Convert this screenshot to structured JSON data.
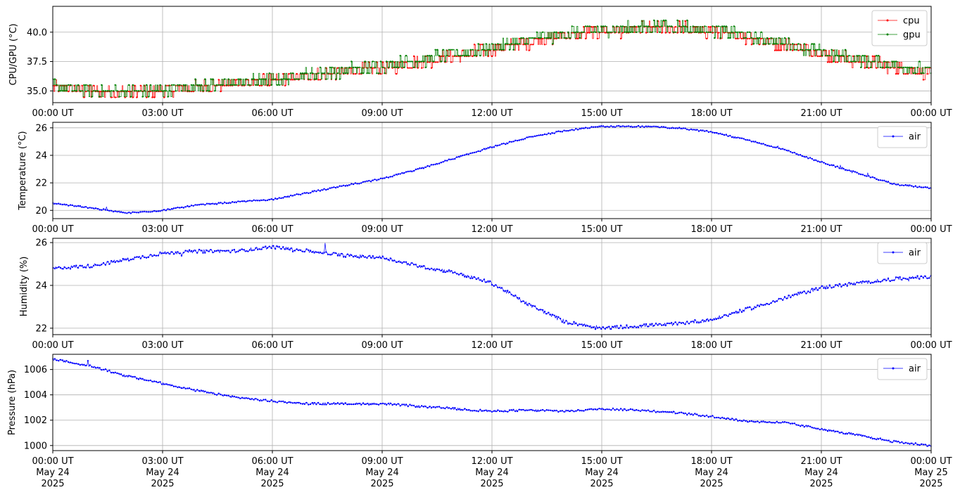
{
  "chart_data": [
    {
      "type": "line",
      "ylabel": "CPU/GPU (°C)",
      "ylim": [
        34.0,
        42.2
      ],
      "yticks": [
        35.0,
        37.5,
        40.0
      ],
      "ytick_labels": [
        "35.0",
        "37.5",
        "40.0"
      ],
      "xlim": [
        0,
        24
      ],
      "xticks": [
        0,
        3,
        6,
        9,
        12,
        15,
        18,
        21,
        24
      ],
      "xtick_labels": [
        "00:00 UT",
        "03:00 UT",
        "06:00 UT",
        "09:00 UT",
        "12:00 UT",
        "15:00 UT",
        "18:00 UT",
        "21:00 UT",
        "00:00 UT"
      ],
      "grid": true,
      "legend": "top-right",
      "noise_amplitude": 0.5,
      "series": [
        {
          "name": "cpu",
          "color": "#ff0000",
          "x": [
            0,
            1,
            2,
            3,
            4,
            5,
            6,
            7,
            8,
            9,
            10,
            11,
            12,
            13,
            14,
            15,
            16,
            17,
            18,
            19,
            20,
            21,
            22,
            23,
            24
          ],
          "y": [
            35.3,
            35.0,
            34.9,
            35.1,
            35.4,
            35.7,
            35.9,
            36.3,
            36.7,
            37.0,
            37.5,
            38.0,
            38.6,
            39.2,
            39.8,
            40.1,
            40.3,
            40.4,
            40.1,
            39.6,
            39.0,
            38.2,
            37.6,
            37.1,
            36.6
          ]
        },
        {
          "name": "gpu",
          "color": "#008000",
          "x": [
            0,
            1,
            2,
            3,
            4,
            5,
            6,
            7,
            8,
            9,
            10,
            11,
            12,
            13,
            14,
            15,
            16,
            17,
            18,
            19,
            20,
            21,
            22,
            23,
            24
          ],
          "y": [
            35.4,
            35.0,
            34.9,
            35.1,
            35.4,
            35.7,
            35.9,
            36.4,
            36.8,
            37.1,
            37.6,
            38.1,
            38.7,
            39.3,
            39.9,
            40.2,
            40.4,
            40.5,
            40.2,
            39.7,
            39.1,
            38.3,
            37.7,
            37.2,
            36.7
          ]
        }
      ]
    },
    {
      "type": "line",
      "ylabel": "Temperature (°C)",
      "ylim": [
        19.4,
        26.4
      ],
      "yticks": [
        20,
        22,
        24,
        26
      ],
      "ytick_labels": [
        "20",
        "22",
        "24",
        "26"
      ],
      "xlim": [
        0,
        24
      ],
      "xticks": [
        0,
        3,
        6,
        9,
        12,
        15,
        18,
        21,
        24
      ],
      "xtick_labels": [
        "00:00 UT",
        "03:00 UT",
        "06:00 UT",
        "09:00 UT",
        "12:00 UT",
        "15:00 UT",
        "18:00 UT",
        "21:00 UT",
        "00:00 UT"
      ],
      "grid": true,
      "legend": "top-right",
      "noise_amplitude": 0.05,
      "series": [
        {
          "name": "air",
          "color": "#0000ff",
          "x": [
            0,
            1,
            2,
            3,
            4,
            5,
            6,
            7,
            8,
            9,
            10,
            11,
            12,
            13,
            14,
            15,
            16,
            17,
            18,
            19,
            20,
            21,
            22,
            23,
            24
          ],
          "y": [
            20.5,
            20.2,
            19.8,
            20.0,
            20.4,
            20.6,
            20.8,
            21.3,
            21.8,
            22.3,
            23.0,
            23.8,
            24.6,
            25.3,
            25.8,
            26.1,
            26.1,
            26.0,
            25.7,
            25.1,
            24.4,
            23.5,
            22.7,
            21.9,
            21.6
          ]
        }
      ]
    },
    {
      "type": "line",
      "ylabel": "Humidity (%)",
      "ylim": [
        21.7,
        26.2
      ],
      "yticks": [
        22,
        24,
        26
      ],
      "ytick_labels": [
        "22",
        "24",
        "26"
      ],
      "xlim": [
        0,
        24
      ],
      "xticks": [
        0,
        3,
        6,
        9,
        12,
        15,
        18,
        21,
        24
      ],
      "xtick_labels": [
        "00:00 UT",
        "03:00 UT",
        "06:00 UT",
        "09:00 UT",
        "12:00 UT",
        "15:00 UT",
        "18:00 UT",
        "21:00 UT",
        "00:00 UT"
      ],
      "grid": true,
      "legend": "top-right",
      "noise_amplitude": 0.08,
      "series": [
        {
          "name": "air",
          "color": "#0000ff",
          "x": [
            0,
            1,
            2,
            3,
            4,
            5,
            6,
            7,
            8,
            9,
            10,
            11,
            12,
            13,
            14,
            15,
            16,
            17,
            18,
            19,
            20,
            21,
            22,
            23,
            24
          ],
          "y": [
            24.8,
            24.9,
            25.2,
            25.5,
            25.6,
            25.6,
            25.8,
            25.6,
            25.4,
            25.3,
            24.9,
            24.6,
            24.1,
            23.1,
            22.3,
            22.0,
            22.1,
            22.2,
            22.4,
            22.9,
            23.4,
            23.9,
            24.1,
            24.3,
            24.4
          ]
        }
      ]
    },
    {
      "type": "line",
      "ylabel": "Pressure (hPa)",
      "ylim": [
        999.6,
        1007.2
      ],
      "yticks": [
        1000,
        1002,
        1004,
        1006
      ],
      "ytick_labels": [
        "1000",
        "1002",
        "1004",
        "1006"
      ],
      "xlim": [
        0,
        24
      ],
      "xticks": [
        0,
        3,
        6,
        9,
        12,
        15,
        18,
        21,
        24
      ],
      "xtick_labels": [
        "00:00 UT",
        "03:00 UT",
        "06:00 UT",
        "09:00 UT",
        "12:00 UT",
        "15:00 UT",
        "18:00 UT",
        "21:00 UT",
        "00:00 UT"
      ],
      "xtick_sublabels": [
        "May 24",
        "May 24",
        "May 24",
        "May 24",
        "May 24",
        "May 24",
        "May 24",
        "May 24",
        "May 25"
      ],
      "xtick_years": [
        "2025",
        "2025",
        "2025",
        "2025",
        "2025",
        "2025",
        "2025",
        "2025",
        "2025"
      ],
      "grid": true,
      "legend": "top-right",
      "noise_amplitude": 0.08,
      "series": [
        {
          "name": "air",
          "color": "#0000ff",
          "x": [
            0,
            1,
            2,
            3,
            4,
            5,
            6,
            7,
            8,
            9,
            10,
            11,
            12,
            13,
            14,
            15,
            16,
            17,
            18,
            19,
            20,
            21,
            22,
            23,
            24
          ],
          "y": [
            1006.8,
            1006.3,
            1005.5,
            1004.9,
            1004.3,
            1003.8,
            1003.5,
            1003.3,
            1003.3,
            1003.3,
            1003.1,
            1002.9,
            1002.7,
            1002.8,
            1002.7,
            1002.9,
            1002.8,
            1002.6,
            1002.3,
            1001.9,
            1001.8,
            1001.3,
            1000.8,
            1000.3,
            1000.0
          ]
        }
      ]
    }
  ]
}
